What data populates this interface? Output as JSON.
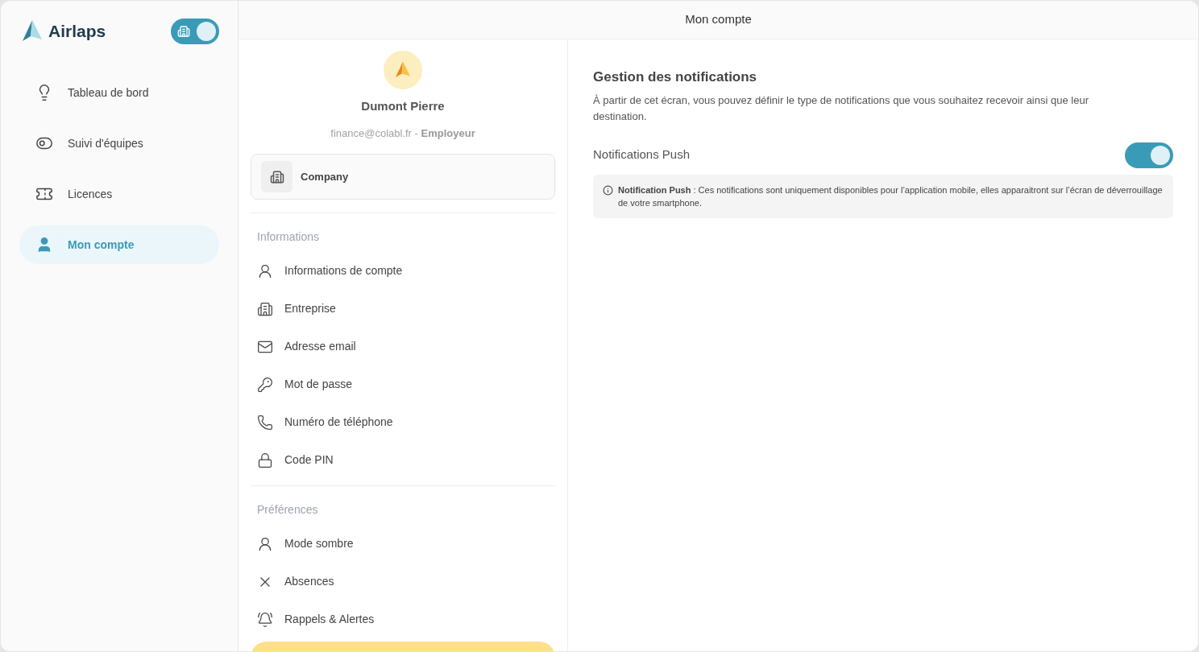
{
  "brand": {
    "name": "Airlaps",
    "mode_switch": {
      "on": true
    }
  },
  "sidebar": {
    "items": [
      {
        "label": "Tableau de bord",
        "selected": false
      },
      {
        "label": "Suivi d'équipes",
        "selected": false
      },
      {
        "label": "Licences",
        "selected": false
      },
      {
        "label": "Mon compte",
        "selected": true
      }
    ]
  },
  "header": {
    "title": "Mon compte"
  },
  "profile": {
    "name": "Dumont Pierre",
    "email": "finance@colabl.fr",
    "separator": "-",
    "role": "Employeur",
    "company": "Company"
  },
  "sections": [
    {
      "title": "Informations",
      "items": [
        {
          "label": "Informations de compte",
          "selected": false
        },
        {
          "label": "Entreprise",
          "selected": false
        },
        {
          "label": "Adresse email",
          "selected": false
        },
        {
          "label": "Mot de passe",
          "selected": false
        },
        {
          "label": "Numéro de téléphone",
          "selected": false
        },
        {
          "label": "Code PIN",
          "selected": false
        }
      ]
    },
    {
      "title": "Préférences",
      "items": [
        {
          "label": "Mode sombre",
          "selected": false
        },
        {
          "label": "Absences",
          "selected": false
        },
        {
          "label": "Rappels & Alertes",
          "selected": false
        },
        {
          "selected": true
        }
      ]
    }
  ],
  "notifications": {
    "title": "Gestion des notifications",
    "description": "À partir de cet écran, vous pouvez définir le type de notifications que vous souhaitez recevoir ainsi que leur destination.",
    "push": {
      "label": "Notifications Push",
      "on": true
    },
    "info": "**Notification Push** : Ces notifications sont uniquement disponibles pour l’application mobile, elles apparaitront sur l’écran de déverrouillage de votre smartphone."
  }
}
